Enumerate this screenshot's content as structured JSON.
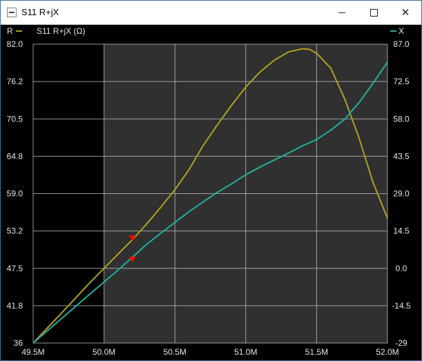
{
  "window": {
    "title": "S11 R+jX",
    "icon": "app-window-icon",
    "controls": [
      "minimize-icon",
      "maximize-icon",
      "close-icon"
    ]
  },
  "legend": {
    "left_label": "R",
    "right_label": "X",
    "center_label": "S11 R+jX (Ω)"
  },
  "colors": {
    "background": "#000000",
    "plot_background": "#303030",
    "r_series": "#b0a020",
    "x_series": "#20b0a0",
    "grid": "#c8c8c8",
    "marker": "#ff0000"
  },
  "chart_data": {
    "type": "line",
    "title": "S11 R+jX (Ω)",
    "xlabel": "",
    "ylabel": "R",
    "y2label": "X",
    "xlim": [
      49.5,
      52.0
    ],
    "ylim": [
      36.0,
      82.0
    ],
    "y2lim": [
      -29.0,
      87.0
    ],
    "x_tick_labels": [
      "49.5M",
      "50.0M",
      "50.5M",
      "51.0M",
      "51.5M",
      "52.0M"
    ],
    "y_tick_labels": [
      "82.0",
      "76.2",
      "70.5",
      "64.8",
      "59.0",
      "53.2",
      "47.5",
      "41.8",
      "36"
    ],
    "y2_tick_labels": [
      "87.0",
      "72.5",
      "58.0",
      "43.5",
      "29.0",
      "14.5",
      "0.0",
      "-14.5",
      "-29"
    ],
    "grid": true,
    "shaded_range": [
      50.0,
      52.0
    ],
    "series": [
      {
        "name": "R",
        "axis": "left",
        "x": [
          49.5,
          49.7,
          49.9,
          50.0,
          50.1,
          50.2,
          50.3,
          50.4,
          50.5,
          50.6,
          50.7,
          50.8,
          50.9,
          51.0,
          51.1,
          51.2,
          51.3,
          51.4,
          51.45,
          51.5,
          51.6,
          51.7,
          51.8,
          51.9,
          52.0
        ],
        "values": [
          36.0,
          40.6,
          45.3,
          47.5,
          49.7,
          51.9,
          54.3,
          56.9,
          59.6,
          62.7,
          66.4,
          69.6,
          72.6,
          75.4,
          77.7,
          79.5,
          80.8,
          81.3,
          81.2,
          80.6,
          78.3,
          73.5,
          67.5,
          60.6,
          55.2
        ]
      },
      {
        "name": "X",
        "axis": "right",
        "x": [
          49.5,
          49.7,
          49.9,
          50.0,
          50.1,
          50.2,
          50.3,
          50.4,
          50.5,
          50.6,
          50.7,
          50.8,
          50.9,
          51.0,
          51.1,
          51.2,
          51.3,
          51.4,
          51.5,
          51.6,
          51.7,
          51.8,
          51.9,
          52.0
        ],
        "values": [
          -29.0,
          -19.5,
          -10.0,
          -5.3,
          -0.6,
          4.3,
          9.3,
          13.6,
          17.8,
          22.0,
          25.8,
          29.5,
          32.8,
          36.3,
          39.3,
          42.0,
          44.7,
          47.5,
          50.0,
          53.6,
          58.0,
          64.4,
          72.0,
          80.0
        ]
      }
    ],
    "markers": [
      {
        "x": 50.2,
        "y": 51.6,
        "axis": "left"
      },
      {
        "x": 50.2,
        "y": 2.1,
        "axis": "right"
      }
    ]
  }
}
